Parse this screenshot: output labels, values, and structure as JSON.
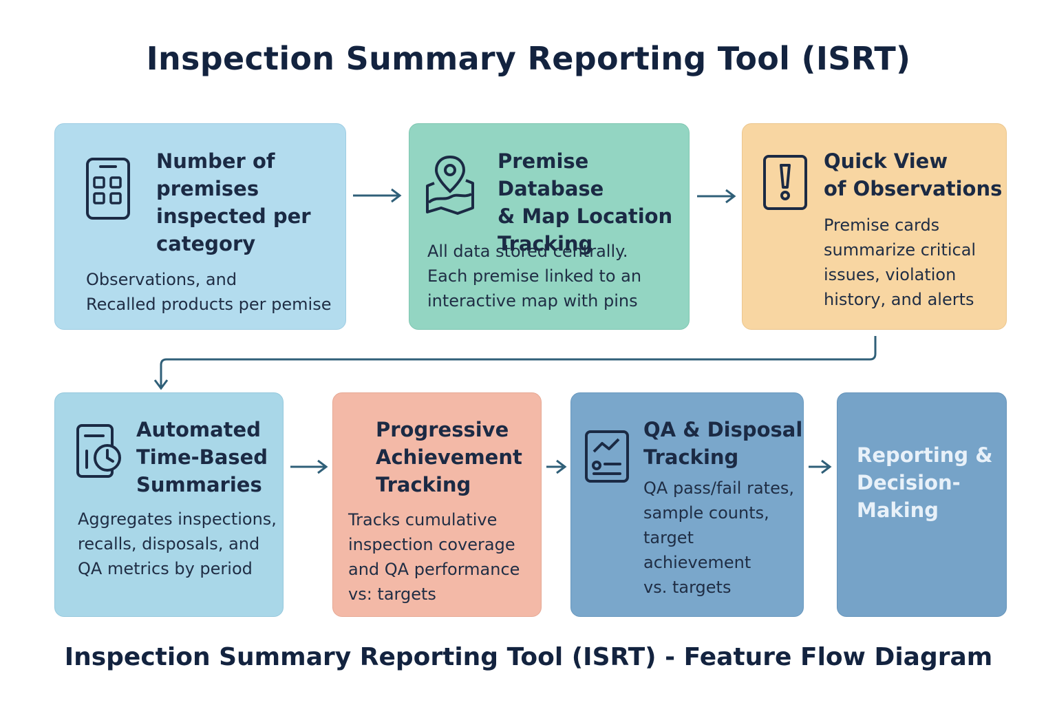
{
  "title": "Inspection Summary Reporting Tool (ISRT)",
  "footer": "Inspection Summary Reporting Tool (ISRT) - Feature Flow Diagram",
  "colors": {
    "box1": "#b3dcee",
    "box2": "#93d5c2",
    "box3": "#f8d6a2",
    "box4": "#a9d7e8",
    "box5": "#f3b9a7",
    "box6": "#7aa7cb",
    "box7": "#76a3c8",
    "connector": "#2f5f78",
    "text": "#1b2a44"
  },
  "nodes": [
    {
      "icon": "grid-app-icon",
      "heading_lines": [
        "Number of",
        "premises",
        "inspected per",
        "category"
      ],
      "desc_lines": [
        "Observations, and",
        "Recalled products per pemise"
      ]
    },
    {
      "icon": "map-pin-icon",
      "heading_lines": [
        "Premise Database",
        "& Map Location",
        "Tracking"
      ],
      "desc_lines": [
        "All data stored centrally.",
        "Each premise linked to an",
        "interactive map with pins"
      ]
    },
    {
      "icon": "alert-card-icon",
      "heading_lines": [
        "Quick View",
        "of Observations"
      ],
      "desc_lines": [
        "Premise cards",
        "summarize critical",
        "issues, violation",
        "history, and alerts"
      ]
    },
    {
      "icon": "calendar-clock-icon",
      "heading_lines": [
        "Automated",
        "Time-Based",
        "Summaries"
      ],
      "desc_lines": [
        "Aggregates inspections,",
        "recalls, disposals, and",
        "QA metrics by period"
      ]
    },
    {
      "icon": "",
      "heading_lines": [
        "Progressive",
        "Achievement",
        "Tracking"
      ],
      "desc_lines": [
        "Tracks cumulative",
        "inspection coverage",
        "and QA performance",
        "vs: targets"
      ]
    },
    {
      "icon": "chart-report-icon",
      "heading_lines": [
        "QA & Disposal",
        "Tracking"
      ],
      "desc_lines": [
        "QA pass/fail rates,",
        "sample counts,",
        "target",
        "achievement",
        "vs. targets"
      ]
    },
    {
      "icon": "",
      "heading_lines": [
        "Reporting &",
        "Decision-",
        "Making"
      ],
      "desc_lines": []
    }
  ]
}
